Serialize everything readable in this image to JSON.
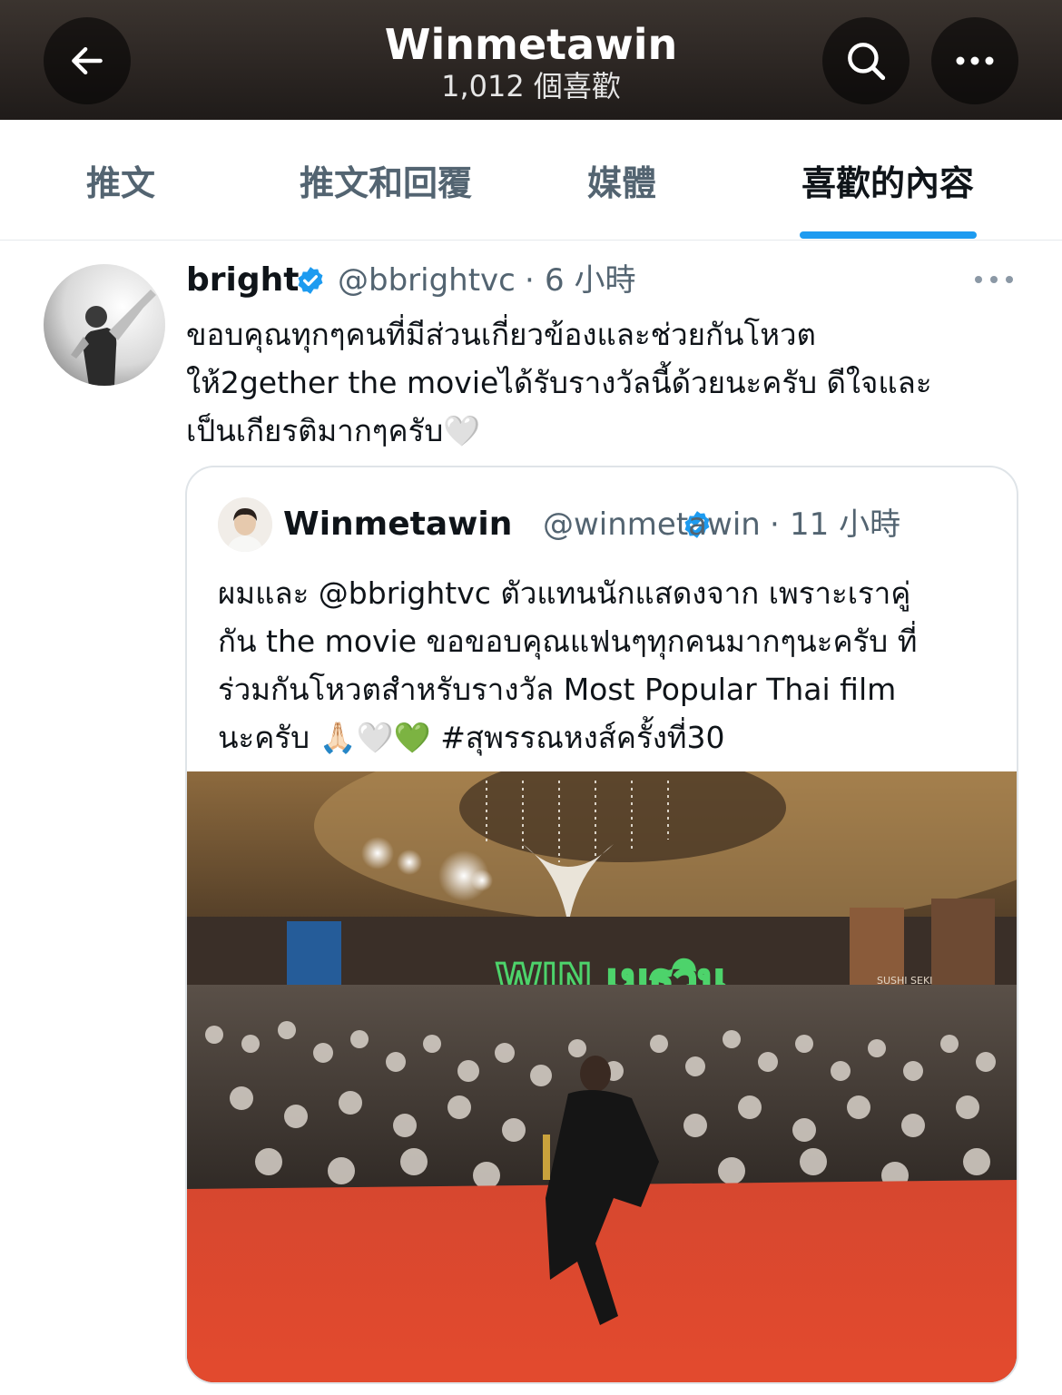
{
  "header": {
    "title": "Winmetawin",
    "subtitle": "1,012 個喜歡",
    "back_icon": "arrow-left-icon",
    "search_icon": "search-icon",
    "more_icon": "more-horizontal-icon"
  },
  "tabs": [
    {
      "label": "推文",
      "active": false
    },
    {
      "label": "推文和回覆",
      "active": false
    },
    {
      "label": "媒體",
      "active": false
    },
    {
      "label": "喜歡的內容",
      "active": true
    }
  ],
  "colors": {
    "accent": "#1d9bf0",
    "text_primary": "#0f1419",
    "text_secondary": "#536471"
  },
  "tweet": {
    "name": "bright",
    "verified": true,
    "handle": "@bbrightvc",
    "separator": "·",
    "time": "6 小時",
    "text": "ขอบคุณทุกๆคนที่มีส่วนเกี่ยวข้องและช่วยกันโหวต\nให้2gether the movieได้รับรางวัลนี้ด้วยนะครับ ดีใจและ\nเป็นเกียรติมากๆครับ🤍",
    "more_icon": "more-horizontal-icon",
    "quote": {
      "name": "Winmetawin",
      "verified": true,
      "handle": "@winmetawin",
      "separator": "·",
      "time": "11 小時",
      "text": "ผมและ @bbrightvc ตัวแทนนักแสดงจาก เพราะเราคู่\nกัน the movie ขอขอบคุณแฟนๆทุกคนมากๆนะครับ ที่\nร่วมกันโหวตสำหรับรางวัล Most Popular Thai film\nนะครับ 🙏🏻🤍💚 #สุพรรณหงส์ครั้งที่30",
      "photo_sign": "WIN เมธวิน",
      "photo_store_sign": "SUSHI SEKI"
    }
  }
}
